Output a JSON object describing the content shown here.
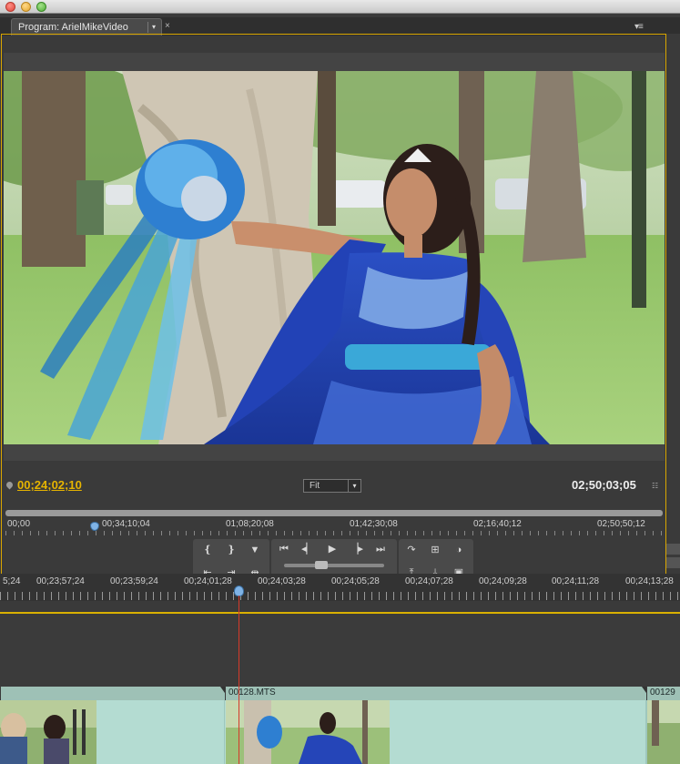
{
  "window": {
    "title": ""
  },
  "program_monitor": {
    "tab_label": "Program: ArielMikeVideo",
    "tab_close": "×",
    "panel_menu": "▾≡",
    "tab_dropdown": "▾",
    "current_timecode": "00;24;02;10",
    "fit_label": "Fit",
    "fit_arrow": "▾",
    "duration_timecode": "02;50;03;05",
    "duration_icon": "☷",
    "ruler_labels": [
      "00;00",
      "00;34;10;04",
      "01;08;20;08",
      "01;42;30;08",
      "02;16;40;12",
      "02;50;50;12"
    ],
    "controls": {
      "mark_in": "❴",
      "mark_out": "❵",
      "add_marker": "▼",
      "go_to_in": "⇤",
      "go_to_out": "⇥",
      "play_in_to_out": "⇹",
      "go_prev_edit": "⏮",
      "step_back": "◂▏",
      "play": "▶",
      "step_forward": "▕▸",
      "go_next_edit": "⏭",
      "loop": "↷",
      "safe_margins": "⊞",
      "output": "◑",
      "lift": "⤒",
      "extract": "⤓",
      "export_frame": "▣"
    }
  },
  "timeline": {
    "ruler_labels": [
      "5;24",
      "00;23;57;24",
      "00;23;59;24",
      "00;24;01;28",
      "00;24;03;28",
      "00;24;05;28",
      "00;24;07;28",
      "00;24;09;28",
      "00;24;11;28",
      "00;24;13;28"
    ],
    "clips": [
      {
        "name": ""
      },
      {
        "name": "00128.MTS"
      },
      {
        "name": "00129"
      }
    ]
  },
  "colors": {
    "accent": "#d9a600",
    "timecode_current": "#e6b400",
    "clip_header": "#9ec1b6",
    "clip_body": "#b4dcd2",
    "playhead_line": "#d63a2a"
  }
}
